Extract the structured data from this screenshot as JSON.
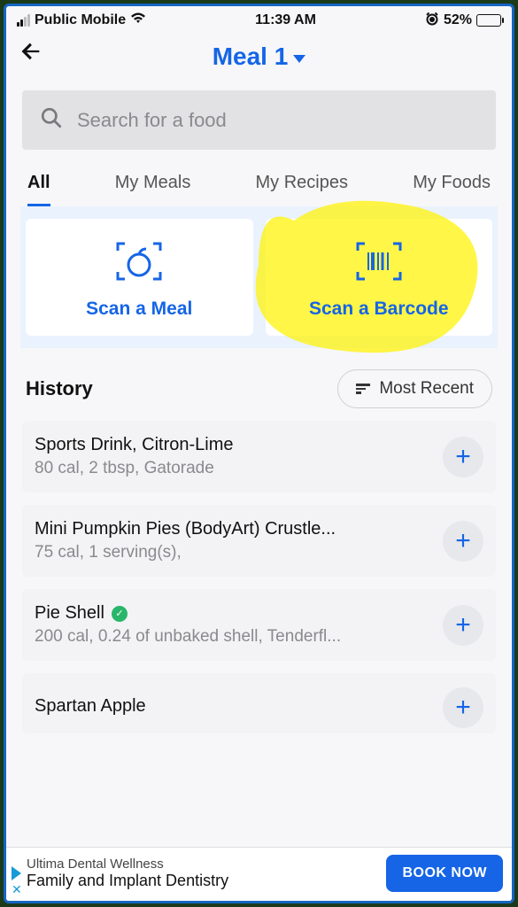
{
  "status": {
    "carrier": "Public Mobile",
    "time": "11:39 AM",
    "battery_pct": "52%"
  },
  "header": {
    "title": "Meal 1"
  },
  "search": {
    "placeholder": "Search for a food"
  },
  "tabs": [
    "All",
    "My Meals",
    "My Recipes",
    "My Foods"
  ],
  "scan": {
    "meal": "Scan a Meal",
    "barcode": "Scan a Barcode"
  },
  "history": {
    "title": "History",
    "sort": "Most Recent",
    "items": [
      {
        "name": "Sports Drink, Citron-Lime",
        "meta": "80 cal, 2 tbsp, Gatorade",
        "verified": false
      },
      {
        "name": "Mini Pumpkin Pies (BodyArt) Crustle...",
        "meta": "75 cal, 1 serving(s),",
        "verified": false
      },
      {
        "name": "Pie Shell",
        "meta": "200 cal, 0.24 of unbaked shell, Tenderfl...",
        "verified": true
      },
      {
        "name": "Spartan Apple",
        "meta": "",
        "verified": false
      }
    ]
  },
  "ad": {
    "line1": "Ultima Dental Wellness",
    "line2": "Family and Implant Dentistry",
    "cta": "BOOK NOW"
  }
}
